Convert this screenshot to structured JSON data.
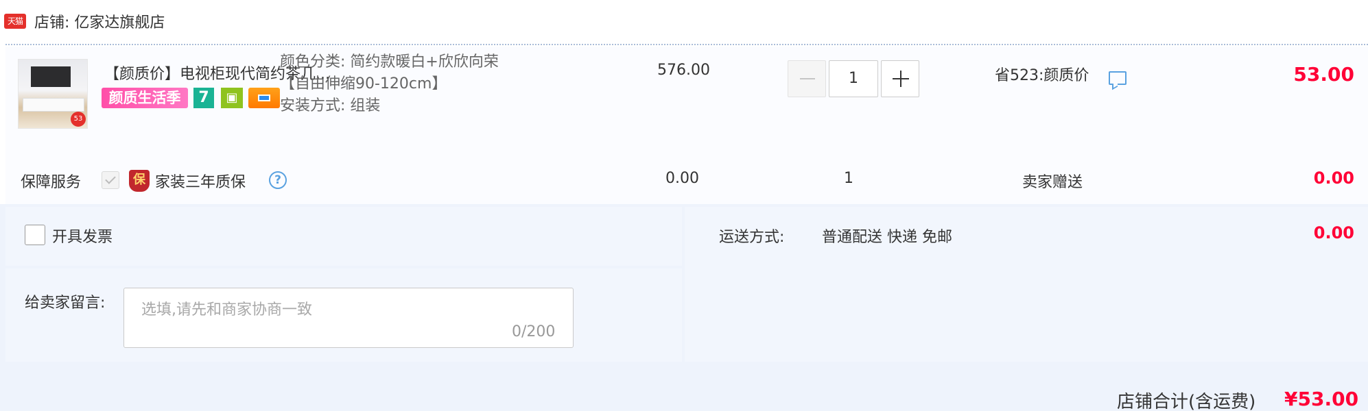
{
  "store": {
    "logo_text": "天猫",
    "label": "店铺: 亿家达旗舰店"
  },
  "item": {
    "title": "【颜质价】电视柜现代简约茶几...",
    "badge_season": "颜质生活季",
    "badge_seven": "7",
    "sku_color": "颜色分类: 简约款暖白+欣欣向荣",
    "sku_size": "【自由伸缩90-120cm】",
    "sku_install": "安装方式: 组装",
    "unit_price": "576.00",
    "quantity": "1",
    "promo": "省523:颜质价",
    "subtotal": "53.00",
    "image_tag": "53"
  },
  "guarantee": {
    "label": "保障服务",
    "icon_text": "保",
    "name": "家装三年质保",
    "help_text": "?",
    "price": "0.00",
    "quantity": "1",
    "gift": "卖家赠送",
    "subtotal": "0.00"
  },
  "invoice": {
    "label": "开具发票"
  },
  "shipping": {
    "label": "运送方式:",
    "methods": "普通配送 快递 免邮",
    "cost": "0.00"
  },
  "message": {
    "label": "给卖家留言:",
    "placeholder": "选填,请先和商家协商一致",
    "counter": "0/200"
  },
  "store_total": {
    "label": "店铺合计(含运费)",
    "value": "¥53.00"
  }
}
